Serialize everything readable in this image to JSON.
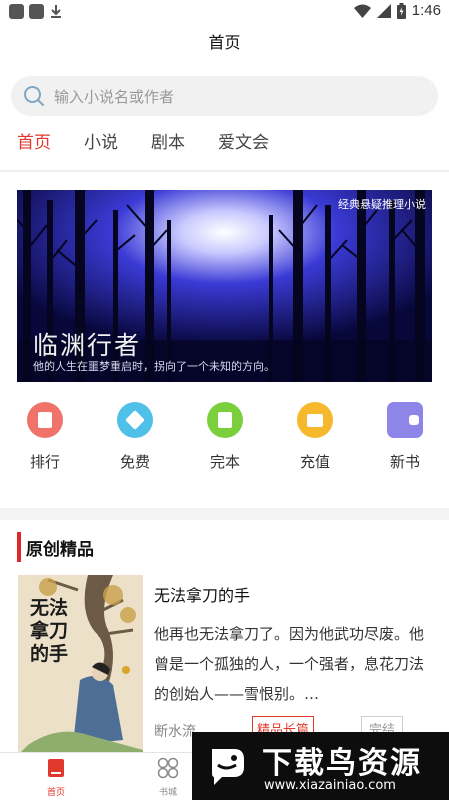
{
  "status_bar": {
    "time": "1:46",
    "icons": [
      "notification-square-icon",
      "notification-square-icon",
      "download-icon",
      "wifi-icon",
      "signal-icon",
      "battery-icon"
    ]
  },
  "header": {
    "title": "首页"
  },
  "search": {
    "placeholder": "输入小说名或作者"
  },
  "tabs": [
    {
      "label": "首页",
      "active": true
    },
    {
      "label": "小说",
      "active": false
    },
    {
      "label": "剧本",
      "active": false
    },
    {
      "label": "爱文会",
      "active": false
    }
  ],
  "banner": {
    "corner_label": "经典悬疑推理小说",
    "title": "临渊行者",
    "subtitle": "他的人生在噩梦重启时，拐向了一个未知的方向。"
  },
  "quick_links": [
    {
      "label": "排行",
      "icon": "book-icon",
      "color": "#f0736b"
    },
    {
      "label": "免费",
      "icon": "diamond-icon",
      "color": "#4fc1e9"
    },
    {
      "label": "完本",
      "icon": "notebook-icon",
      "color": "#7ccf3c"
    },
    {
      "label": "充值",
      "icon": "wallet-icon",
      "color": "#f6b82d"
    },
    {
      "label": "新书",
      "icon": "wallet-card-icon",
      "color": "#8d86e8"
    }
  ],
  "section": {
    "title": "原创精品"
  },
  "featured_book": {
    "title": "无法拿刀的手",
    "description": "他再也无法拿刀了。因为他武功尽废。他曾是一个孤独的人，一个强者，息花刀法的创始人——雪恨别。…",
    "author": "断水流",
    "tag_primary": "精品长篇",
    "tag_status": "完结",
    "cover_title": "无法拿刀的手"
  },
  "bottom_nav": [
    {
      "label": "首页",
      "icon": "home-book-icon",
      "active": true
    },
    {
      "label": "书城",
      "icon": "grid-icon",
      "active": false
    }
  ],
  "watermark": {
    "name": "下载鸟资源",
    "url": "www.xiazainiao.com"
  },
  "colors": {
    "accent": "#e0382c"
  }
}
